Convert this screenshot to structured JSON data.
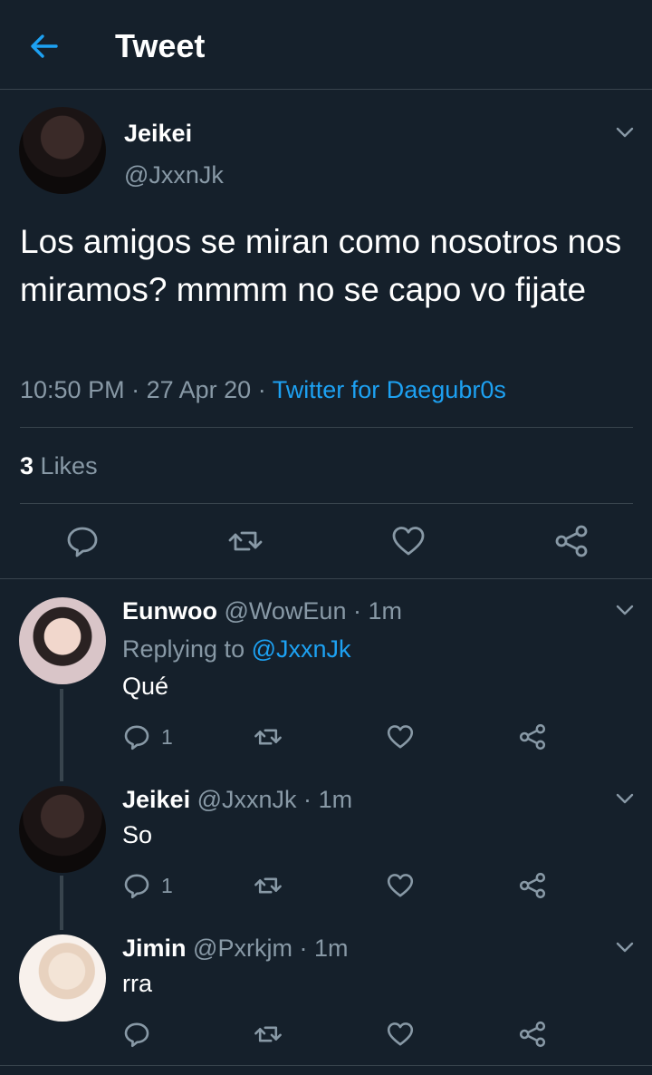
{
  "header": {
    "title": "Tweet",
    "back_icon": "arrow-left-icon",
    "accent": "#1da1f2"
  },
  "main_tweet": {
    "name": "Jeikei",
    "handle": "@JxxnJk",
    "text": "Los amigos se miran como nosotros nos miramos? mmmm no se capo vo fijate",
    "time": "10:50 PM",
    "date": "27 Apr 20",
    "source": "Twitter for Daegubr0s",
    "likes_count": "3",
    "likes_label": "Likes"
  },
  "replies": [
    {
      "name": "Eunwoo",
      "handle": "@WowEun",
      "time": "1m",
      "replying_prefix": "Replying to",
      "replying_to": "@JxxnJk",
      "text": "Qué",
      "reply_count": "1"
    },
    {
      "name": "Jeikei",
      "handle": "@JxxnJk",
      "time": "1m",
      "text": "So",
      "reply_count": "1"
    },
    {
      "name": "Jimin",
      "handle": "@Pxrkjm",
      "time": "1m",
      "text": "rra",
      "reply_count": ""
    }
  ],
  "separator": "·",
  "colors": {
    "background": "#15202b",
    "muted": "#8899a6",
    "border": "#38444d",
    "link": "#1da1f2"
  }
}
